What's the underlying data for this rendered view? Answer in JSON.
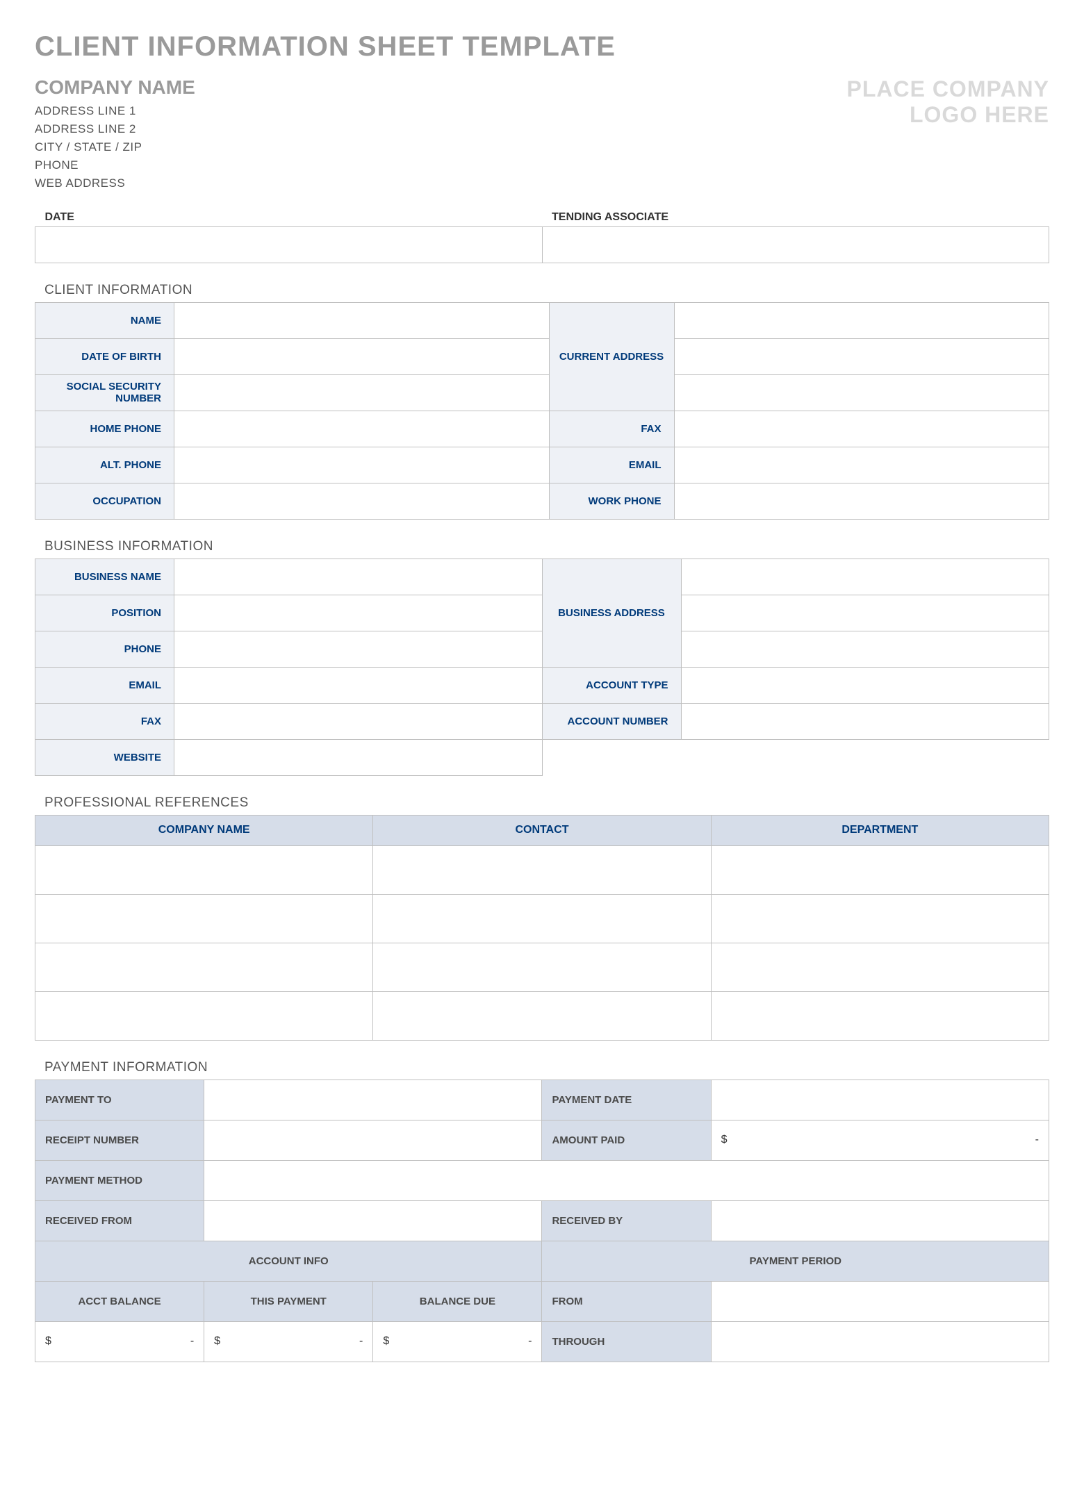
{
  "title": "CLIENT INFORMATION SHEET TEMPLATE",
  "company": {
    "name": "COMPANY NAME",
    "lines": [
      "ADDRESS LINE 1",
      "ADDRESS LINE 2",
      "CITY / STATE / ZIP",
      "PHONE",
      "WEB ADDRESS"
    ],
    "logo_placeholder_line1": "PLACE COMPANY",
    "logo_placeholder_line2": "LOGO HERE"
  },
  "top_fields": {
    "date_label": "DATE",
    "date_value": "",
    "tending_label": "TENDING ASSOCIATE",
    "tending_value": ""
  },
  "client_info": {
    "section_title": "CLIENT INFORMATION",
    "labels": {
      "name": "NAME",
      "dob": "DATE OF BIRTH",
      "ssn": "SOCIAL SECURITY NUMBER",
      "home_phone": "HOME PHONE",
      "alt_phone": "ALT. PHONE",
      "occupation": "OCCUPATION",
      "current_address": "CURRENT ADDRESS",
      "fax": "FAX",
      "email": "EMAIL",
      "work_phone": "WORK PHONE"
    },
    "values": {
      "name": "",
      "dob": "",
      "ssn": "",
      "home_phone": "",
      "alt_phone": "",
      "occupation": "",
      "addr1": "",
      "addr2": "",
      "addr3": "",
      "fax": "",
      "email": "",
      "work_phone": ""
    }
  },
  "business_info": {
    "section_title": "BUSINESS INFORMATION",
    "labels": {
      "business_name": "BUSINESS NAME",
      "position": "POSITION",
      "phone": "PHONE",
      "email": "EMAIL",
      "fax": "FAX",
      "website": "WEBSITE",
      "business_address": "BUSINESS ADDRESS",
      "account_type": "ACCOUNT TYPE",
      "account_number": "ACCOUNT NUMBER"
    },
    "values": {
      "business_name": "",
      "position": "",
      "phone": "",
      "email": "",
      "fax": "",
      "website": "",
      "addr1": "",
      "addr2": "",
      "addr3": "",
      "account_type": "",
      "account_number": ""
    }
  },
  "references": {
    "section_title": "PROFESSIONAL REFERENCES",
    "headers": {
      "company": "COMPANY NAME",
      "contact": "CONTACT",
      "department": "DEPARTMENT"
    },
    "rows": [
      {
        "company": "",
        "contact": "",
        "department": ""
      },
      {
        "company": "",
        "contact": "",
        "department": ""
      },
      {
        "company": "",
        "contact": "",
        "department": ""
      },
      {
        "company": "",
        "contact": "",
        "department": ""
      }
    ]
  },
  "payment": {
    "section_title": "PAYMENT INFORMATION",
    "labels": {
      "payment_to": "PAYMENT TO",
      "payment_date": "PAYMENT DATE",
      "receipt_number": "RECEIPT NUMBER",
      "amount_paid": "AMOUNT PAID",
      "payment_method": "PAYMENT METHOD",
      "received_from": "RECEIVED FROM",
      "received_by": "RECEIVED BY",
      "account_info": "ACCOUNT INFO",
      "payment_period": "PAYMENT PERIOD",
      "acct_balance": "ACCT BALANCE",
      "this_payment": "THIS PAYMENT",
      "balance_due": "BALANCE DUE",
      "from": "FROM",
      "through": "THROUGH"
    },
    "values": {
      "payment_to": "",
      "payment_date": "",
      "receipt_number": "",
      "amount_paid_currency": "$",
      "amount_paid_dash": "-",
      "payment_method": "",
      "received_from": "",
      "received_by": "",
      "acct_balance_currency": "$",
      "acct_balance_dash": "-",
      "this_payment_currency": "$",
      "this_payment_dash": "-",
      "balance_due_currency": "$",
      "balance_due_dash": "-",
      "from": "",
      "through": ""
    }
  }
}
